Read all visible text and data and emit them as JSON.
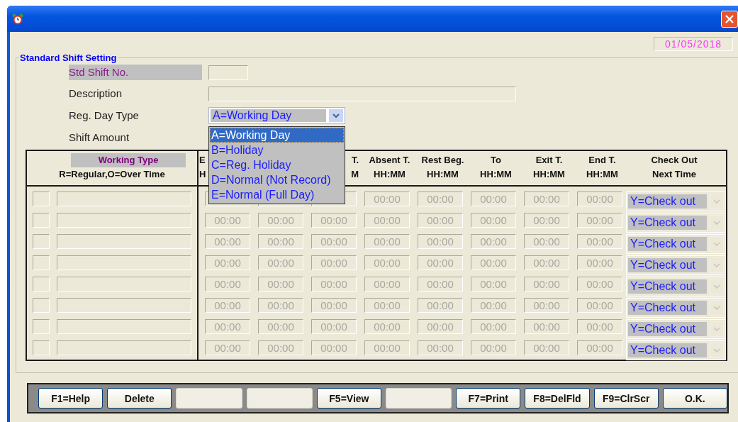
{
  "date": "01/05/2018",
  "group_title": "Standard Shift Setting",
  "form": {
    "std_shift_no": {
      "label": "Std Shift No."
    },
    "description": {
      "label": "Description"
    },
    "reg_day_type": {
      "label": "Reg. Day Type",
      "value": "A=Working Day",
      "expanded": true,
      "options": [
        {
          "label": "A=Working Day",
          "selected": true
        },
        {
          "label": "B=Holiday",
          "selected": false
        },
        {
          "label": "C=Reg. Holiday",
          "selected": false
        },
        {
          "label": "D=Normal (Not Record)",
          "selected": false
        },
        {
          "label": "E=Normal (Full Day)",
          "selected": false
        }
      ]
    },
    "shift_amount": {
      "label": "Shift Amount"
    }
  },
  "table": {
    "working_type": {
      "title": "Working Type",
      "legend": "R=Regular,O=Over Time"
    },
    "columns": [
      {
        "line1": "E",
        "line2": "H"
      },
      {},
      {
        "line1": "T.",
        "line2": "M"
      },
      {
        "line1": "Absent T.",
        "line2": "HH:MM"
      },
      {
        "line1": "Rest Beg.",
        "line2": "HH:MM"
      },
      {
        "line1": "To",
        "line2": "HH:MM"
      },
      {
        "line1": "Exit T.",
        "line2": "HH:MM"
      },
      {
        "line1": "End T.",
        "line2": "HH:MM"
      },
      {
        "line1": "Check Out",
        "line2": "Next Time"
      }
    ],
    "rows": [
      {
        "times": [
          "00:00",
          "00:00",
          "00:00",
          "00:00",
          "00:00"
        ],
        "check_out": "Y=Check out"
      },
      {
        "times": [
          "00:00",
          "00:00",
          "00:00",
          "00:00",
          "00:00",
          "00:00",
          "00:00",
          "00:00"
        ],
        "check_out": "Y=Check out"
      },
      {
        "times": [
          "00:00",
          "00:00",
          "00:00",
          "00:00",
          "00:00",
          "00:00",
          "00:00",
          "00:00"
        ],
        "check_out": "Y=Check out"
      },
      {
        "times": [
          "00:00",
          "00:00",
          "00:00",
          "00:00",
          "00:00",
          "00:00",
          "00:00",
          "00:00"
        ],
        "check_out": "Y=Check out"
      },
      {
        "times": [
          "00:00",
          "00:00",
          "00:00",
          "00:00",
          "00:00",
          "00:00",
          "00:00",
          "00:00"
        ],
        "check_out": "Y=Check out"
      },
      {
        "times": [
          "00:00",
          "00:00",
          "00:00",
          "00:00",
          "00:00",
          "00:00",
          "00:00",
          "00:00"
        ],
        "check_out": "Y=Check out"
      },
      {
        "times": [
          "00:00",
          "00:00",
          "00:00",
          "00:00",
          "00:00",
          "00:00",
          "00:00",
          "00:00"
        ],
        "check_out": "Y=Check out"
      },
      {
        "times": [
          "00:00",
          "00:00",
          "00:00",
          "00:00",
          "00:00",
          "00:00",
          "00:00",
          "00:00"
        ],
        "check_out": "Y=Check out"
      }
    ]
  },
  "toolbar": [
    {
      "kind": "button",
      "label": "F1=Help"
    },
    {
      "kind": "button",
      "label": "Delete"
    },
    {
      "kind": "blank"
    },
    {
      "kind": "blank"
    },
    {
      "kind": "button",
      "label": "F5=View"
    },
    {
      "kind": "blank"
    },
    {
      "kind": "button",
      "label": "F7=Print"
    },
    {
      "kind": "button",
      "label": "F8=DelFld"
    },
    {
      "kind": "button",
      "label": "F9=ClrScr"
    },
    {
      "kind": "button",
      "label": "O.K."
    }
  ]
}
